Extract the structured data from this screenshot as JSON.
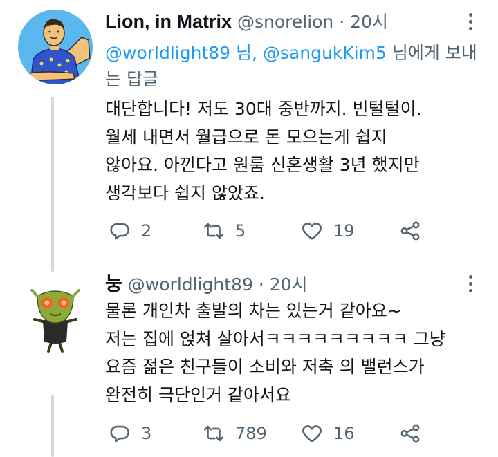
{
  "tweets": [
    {
      "name": "Lion, in Matrix",
      "handle": "@snorelion",
      "dot": "·",
      "time": "20시",
      "reply_to": {
        "mention1": "@worldlight89",
        "sep": " 님, ",
        "mention2": "@sangukKim5",
        "suffix": " 님에게 보내는 답글"
      },
      "lines": [
        "대단합니다! 저도 30대 중반까지. 빈털털이.",
        "월세 내면서 월급으로 돈 모으는게 쉽지",
        "않아요. 아낀다고 원룸 신혼생활 3년 했지만",
        "생각보다 쉽지 않았죠."
      ],
      "replies": "2",
      "retweets": "5",
      "likes": "19"
    },
    {
      "name": "눙",
      "handle": "@worldlight89",
      "dot": "·",
      "time": "20시",
      "lines": [
        "물론 개인차 출발의 차는 있는거 같아요~",
        "저는 집에 얹쳐 살아서ㅋㅋㅋㅋㅋㅋㅋㅋㅋ 그냥",
        "요즘 젊은 친구들이 소비와 저축 의 밸런스가",
        "완전히 극단인거 같아서요"
      ],
      "replies": "3",
      "retweets": "789",
      "likes": "16"
    }
  ],
  "icons": {
    "reply": "reply-icon",
    "retweet": "retweet-icon",
    "like": "like-icon",
    "share": "share-icon",
    "more": "more-icon"
  },
  "colors": {
    "link": "#1d9bf0",
    "secondary_text": "#536471",
    "thread_line": "#cfd9de",
    "avatar1_bg": "#5bb8ee",
    "avatar1_shirt": "#2f55c9"
  }
}
